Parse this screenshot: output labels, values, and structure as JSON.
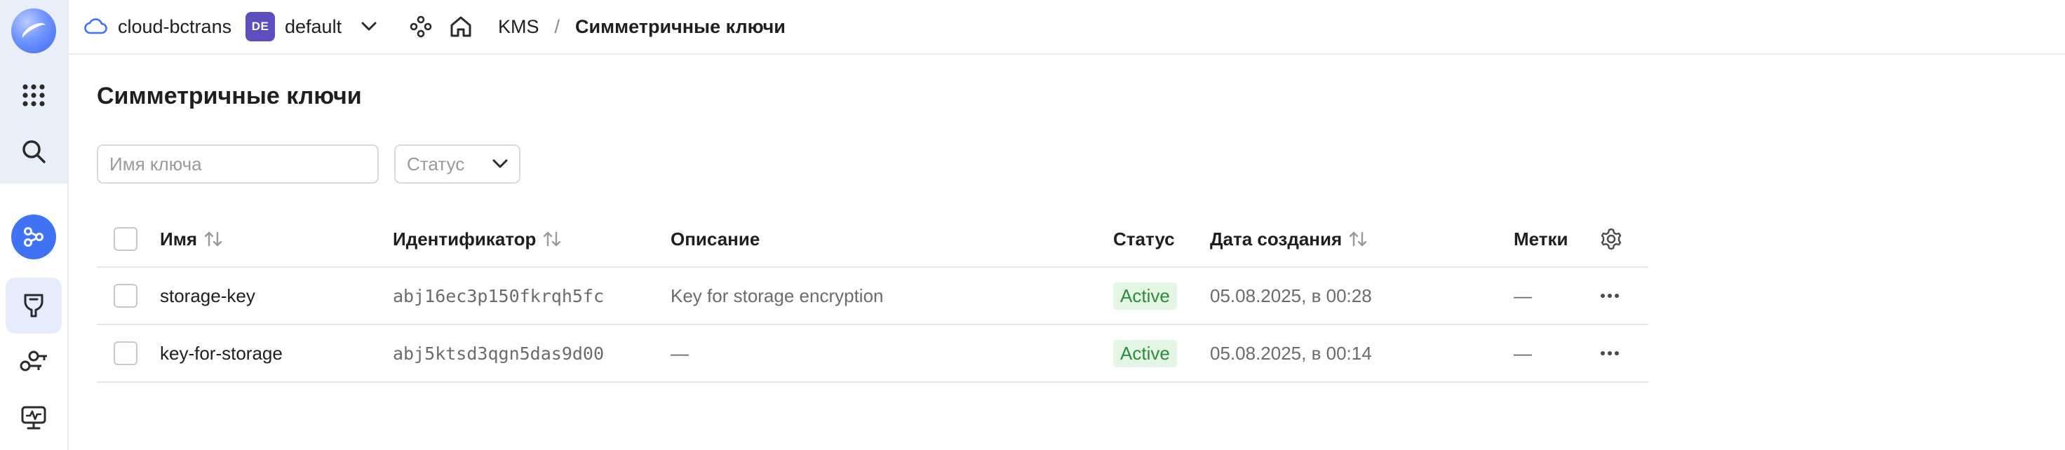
{
  "breadcrumb": {
    "cloud": "cloud-bctrans",
    "folder_badge": "DE",
    "folder": "default",
    "service": "KMS",
    "separator": "/",
    "current": "Симметричные ключи"
  },
  "page": {
    "title": "Симметричные ключи"
  },
  "filters": {
    "name_placeholder": "Имя ключа",
    "status_placeholder": "Статус"
  },
  "table": {
    "columns": {
      "name": "Имя",
      "id": "Идентификатор",
      "description": "Описание",
      "status": "Статус",
      "created": "Дата создания",
      "labels": "Метки"
    },
    "rows": [
      {
        "name": "storage-key",
        "id": "abj16ec3p150fkrqh5fc",
        "description": "Key for storage encryption",
        "status": "Active",
        "created": "05.08.2025, в 00:28",
        "labels": "—"
      },
      {
        "name": "key-for-storage",
        "id": "abj5ktsd3qgn5das9d00",
        "description": "—",
        "status": "Active",
        "created": "05.08.2025, в 00:14",
        "labels": "—"
      }
    ]
  },
  "colors": {
    "accent": "#3f72f5",
    "status_active_bg": "#e3f5e4",
    "status_active_text": "#2e8a3c",
    "folder_badge": "#5c4fbd"
  }
}
